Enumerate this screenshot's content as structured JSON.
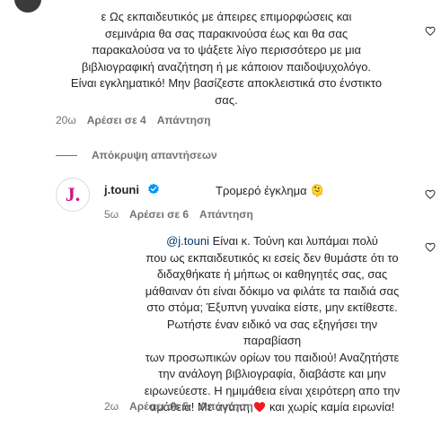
{
  "comment1": {
    "text_lines": [
      "ε Ως εκπαιδευτικός με άπειρες επιμορφώσεις και",
      "σεμινάρια θα σας παρακινούσα έως και θα σας",
      "παρακαλούσα να το ψάξετε λίγο περισσότερο με μια",
      "βιβλιογραφική αναζήτηση ή με κάποιον παιδοψυχολόγο.",
      "Είναι εγκληματικό! Μην βασίζεστε αποκλειστικά στο ένστικτο",
      "σας."
    ],
    "time": "20ω",
    "likes": "Αρέσει σε 4",
    "reply": "Απάντηση"
  },
  "hide_replies": "Απόκρυψη απαντήσεων",
  "comment2": {
    "username": "j.touni",
    "avatar_letter": "J.",
    "text": "Τρομερό έγκλημα 🫠",
    "time": "5ω",
    "likes": "Αρέσει σε 6",
    "reply": "Απάντηση"
  },
  "comment3": {
    "mention": "@j.touni",
    "first_line_rest": " Είναι κ. Τούνη και λυπάμαι πολύ",
    "text_lines": [
      "που ως εκπαιδευτικός κι εσείς δεν θυμάστε ότι το",
      "διδαχθήκατε ή μήπως οι καθηγητές σας, σας",
      "μάθαιναν ότι είναι δόκιμο να φιλάτε τα παιδιά σας",
      "στο στόμα; Έξυπνη γυναίκα είστε, μην εκτίθεστε.",
      "Ρωτήστε έναν ειδικό να σας εξηγήσει την παραβίαση",
      "των προσωπικών ορίων του παιδιού! Αναζητήστε",
      "την ανάλογη βιβλιογραφία, διαβάστε και μην",
      "ειρωνεύεστε. Η ημιμάθεια είναι χειρότερη απο την",
      "αμάθεια! Με αγάπη"
    ],
    "last_line_after_heart": "και χωρίς καμία ειρωνία!",
    "time": "2ω",
    "likes": "Αρέσει σε 5",
    "reply": "Απάντηση"
  },
  "colors": {
    "text": "#262626",
    "secondary": "#737373",
    "mention": "#00376b",
    "verified": "#0095f6",
    "heart_red": "#ed1c24",
    "avatar_j": "#c9177e"
  },
  "icons": [
    "heart-outline-icon",
    "verified-badge-icon",
    "red-heart-emoji-icon"
  ]
}
